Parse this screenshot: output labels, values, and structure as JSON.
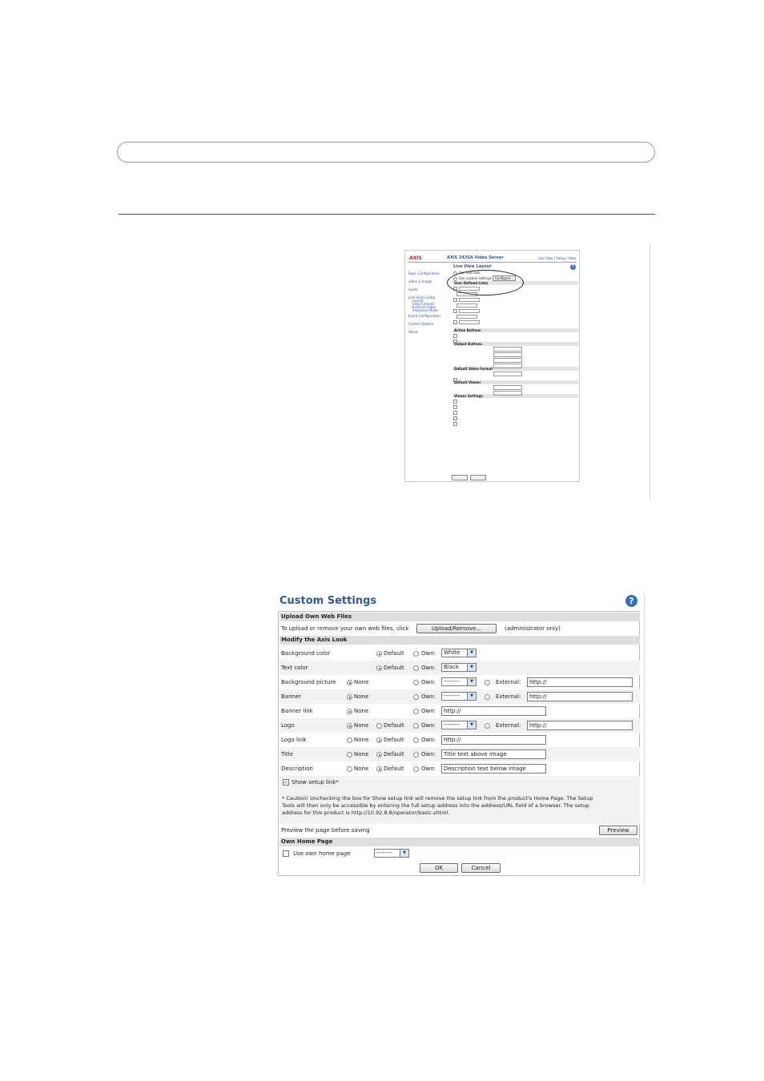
{
  "small_screenshot": {
    "logo": "AXIS",
    "title": "AXIS 243SA Video Server",
    "top_links": "Live View | Setup | Help",
    "nav": [
      "Basic Configuration",
      "Video & Image",
      "Audio",
      "Live View Config",
      "Event Configuration",
      "System Options",
      "About"
    ],
    "nav_sub": [
      "Layout",
      "View Controls",
      "External Video",
      "Sequence Mode"
    ],
    "heading": "Live View Layout",
    "opt1": "Use Axis look",
    "opt2": "Use custom settings",
    "configure": "Configure...",
    "sec_links": "User Defined Links",
    "sec_action": "Action Buttons",
    "sec_output": "Output Buttons",
    "sec_video": "Default Video Format",
    "sec_viewer": "Default Viewer",
    "sec_viewer_settings": "Viewer Settings",
    "save": "Save",
    "reset": "Reset"
  },
  "custom": {
    "title": "Custom Settings",
    "help_icon": "?",
    "upload_header": "Upload Own Web Files",
    "upload_text": "To upload or remove your own web files, click",
    "upload_button": "Upload/Remove...",
    "upload_note": "(administrator only)",
    "modify_header": "Modify the Axis Look",
    "none": "None",
    "default": "Default",
    "own": "Own:",
    "external": "External:",
    "bg_color": "Background color",
    "bg_color_val": "White",
    "text_color": "Text color",
    "text_color_val": "Black",
    "bg_picture": "Background picture",
    "banner": "Banner",
    "banner_link": "Banner link",
    "logo": "Logo",
    "logo_link": "Logo link",
    "title_lbl": "Title",
    "description": "Description",
    "dash_select": "--------",
    "http": "http://",
    "title_text": "Title text above image",
    "desc_text": "Description text below image",
    "show_setup": "Show setup link*",
    "note_line1": "* Caution! Unchecking the box for Show setup link will remove the setup link from the product's Home Page. The Setup",
    "note_line2": "Tools will then only be accessible by entering the full setup address into the address/URL field of a browser. The setup",
    "note_line3": "address for this product is http://10.92.8.8/operator/basic.shtml.",
    "preview_text": "Preview the page before saving",
    "preview_button": "Preview",
    "home_header": "Own Home Page",
    "use_home": "Use own home page",
    "ok": "OK",
    "cancel": "Cancel"
  }
}
